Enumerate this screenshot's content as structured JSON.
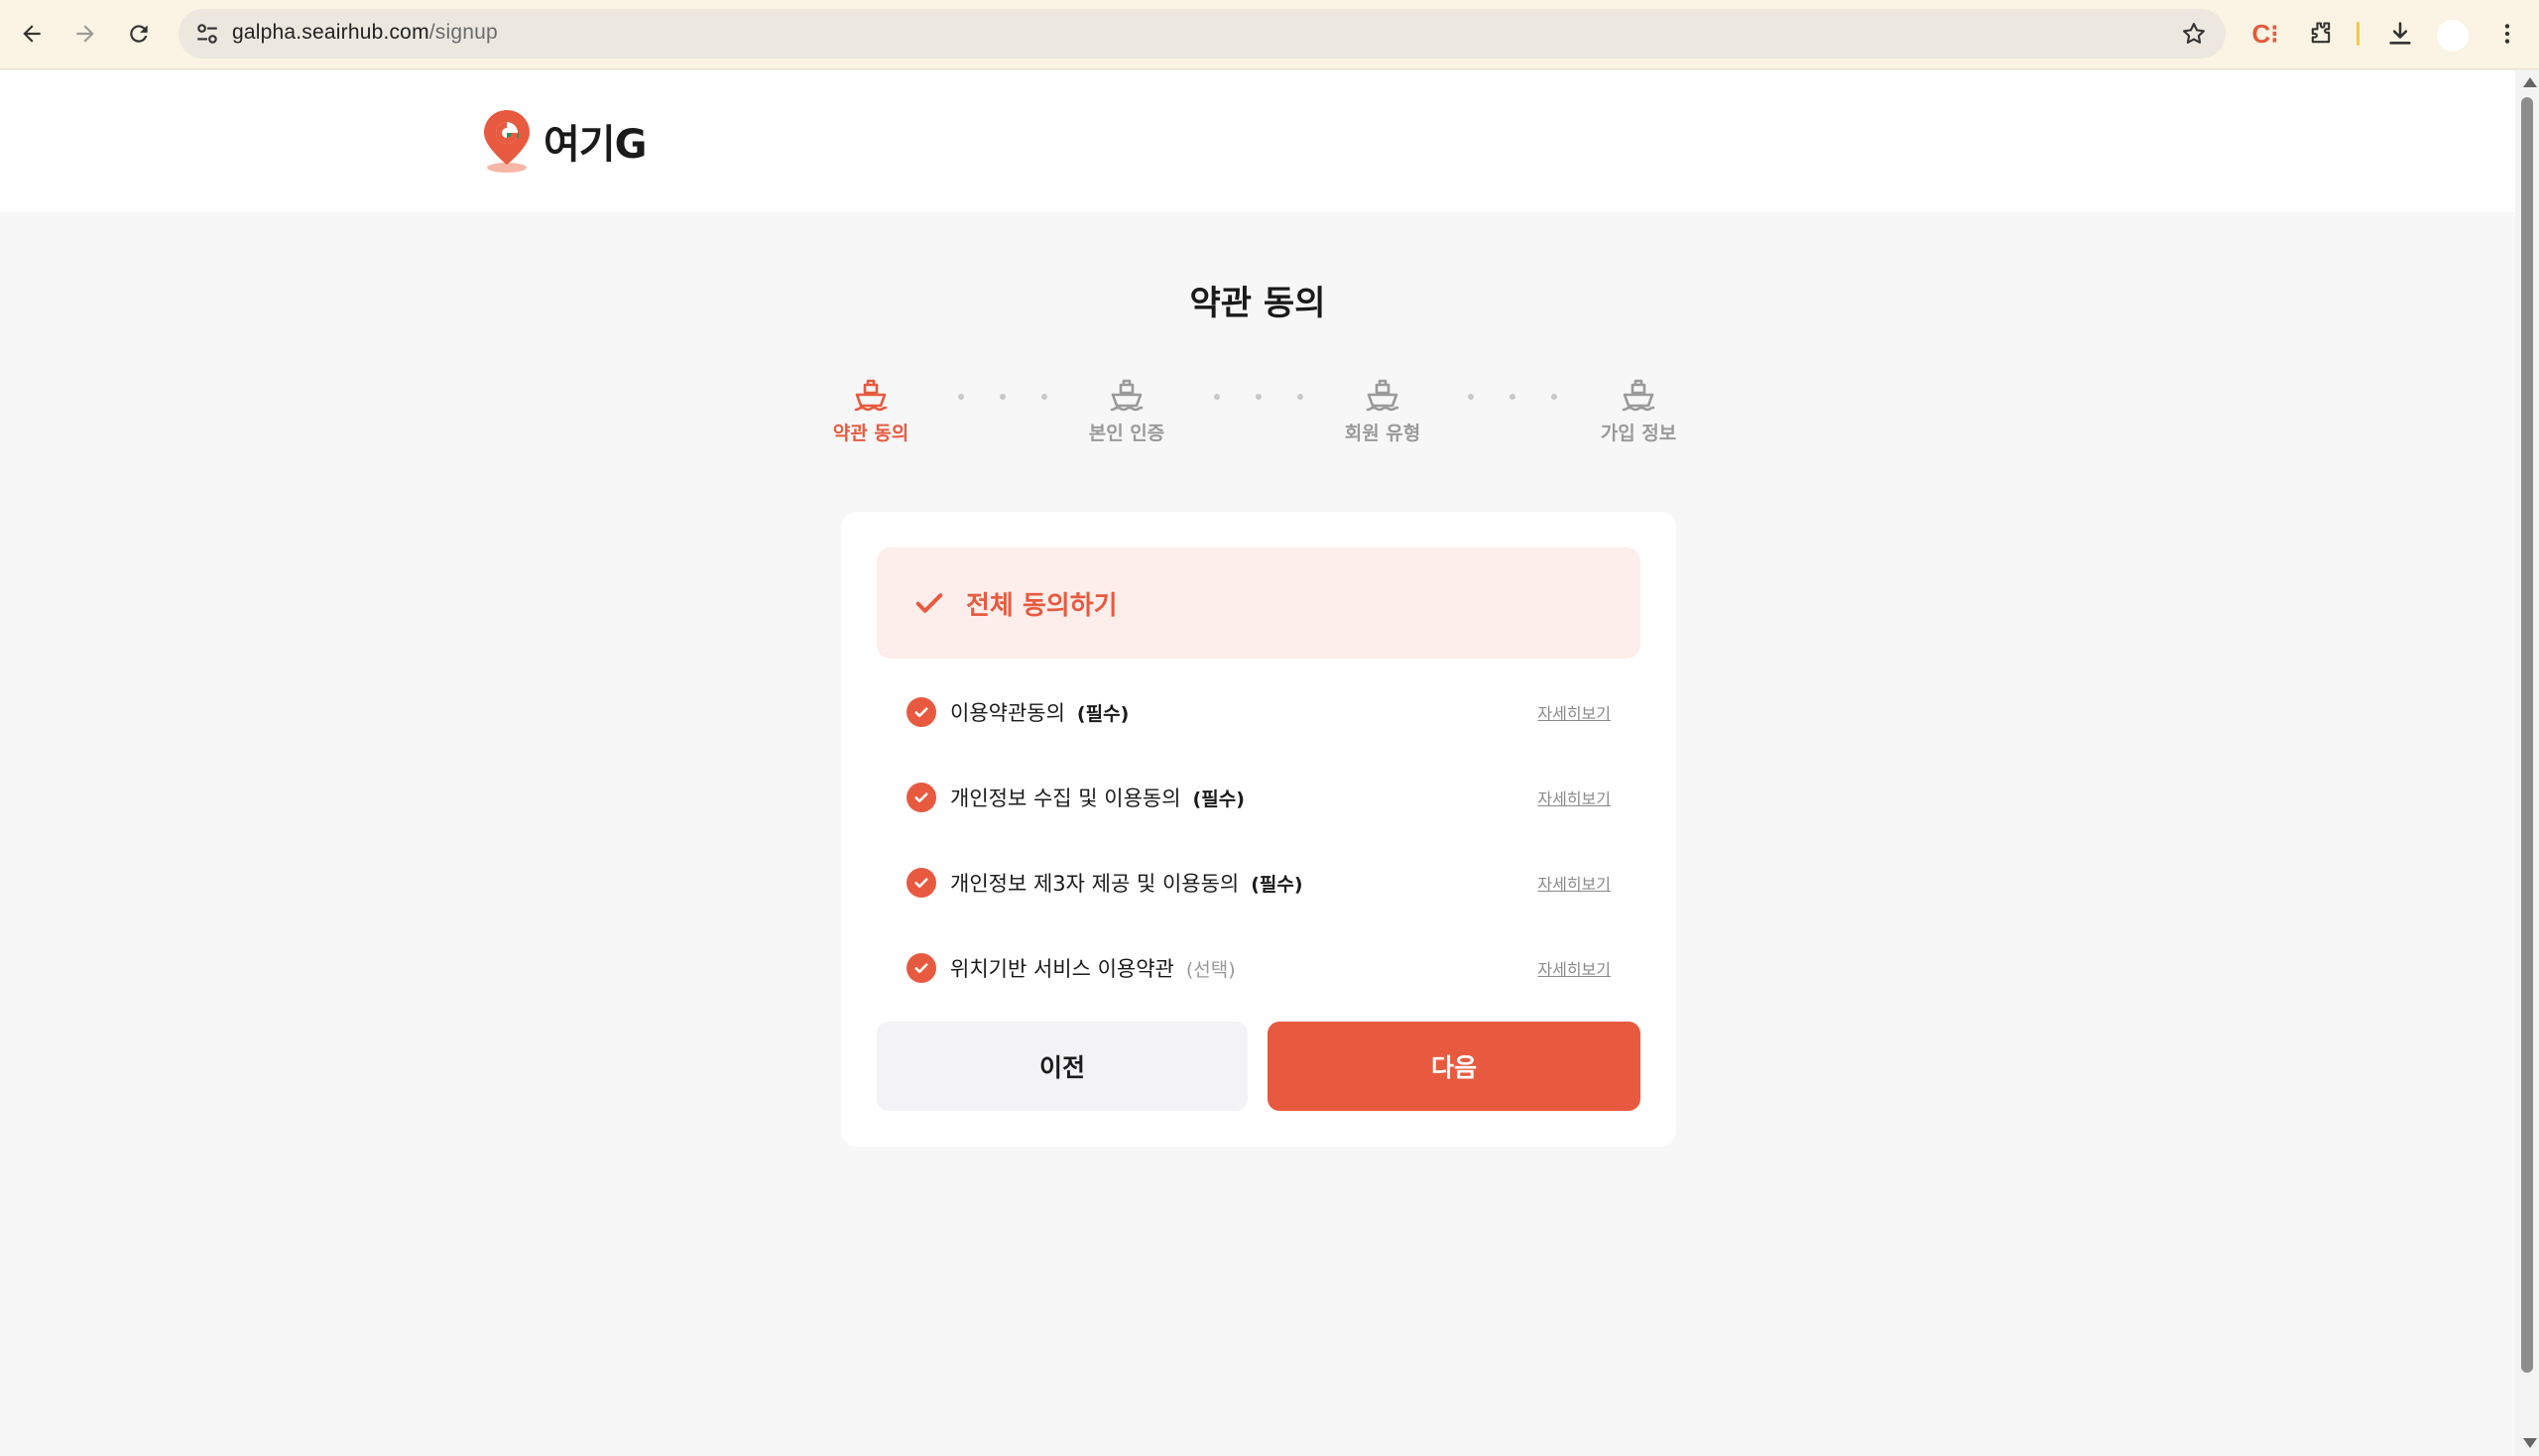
{
  "browser": {
    "url_host": "galpha.seairhub.com",
    "url_path": "/signup",
    "extension_label": "C⁝"
  },
  "site": {
    "logo_text": "여기G"
  },
  "page": {
    "title": "약관 동의"
  },
  "steps": [
    {
      "label": "약관 동의",
      "active": true
    },
    {
      "label": "본인 인증",
      "active": false
    },
    {
      "label": "회원 유형",
      "active": false
    },
    {
      "label": "가입 정보",
      "active": false
    }
  ],
  "agreement": {
    "all_label": "전체 동의하기",
    "terms": [
      {
        "name": "이용약관동의",
        "tag": "(필수)",
        "detail": "자세히보기",
        "checked": true
      },
      {
        "name": "개인정보 수집 및 이용동의",
        "tag": "(필수)",
        "detail": "자세히보기",
        "checked": true
      },
      {
        "name": "개인정보 제3자 제공 및 이용동의",
        "tag": "(필수)",
        "detail": "자세히보기",
        "checked": true
      },
      {
        "name": "위치기반 서비스 이용약관",
        "tag": "(선택)",
        "detail": "자세히보기",
        "checked": true
      }
    ]
  },
  "buttons": {
    "prev": "이전",
    "next": "다음"
  },
  "colors": {
    "accent": "#e85a3f",
    "accent_light": "#fdeeeb",
    "inactive": "#9a9a9a",
    "background": "#f7f7f7"
  }
}
